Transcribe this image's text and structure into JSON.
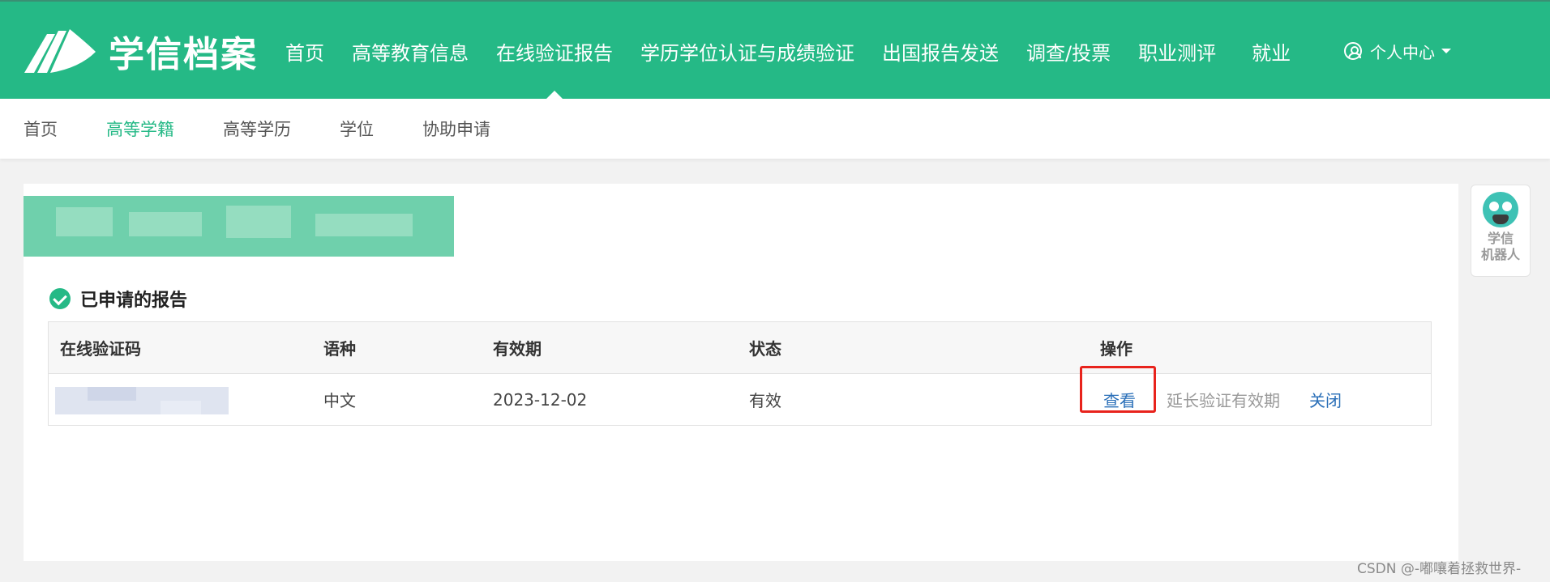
{
  "header": {
    "logo_text": "学信档案",
    "nav": [
      {
        "label": "首页",
        "active": false
      },
      {
        "label": "高等教育信息",
        "active": false
      },
      {
        "label": "在线验证报告",
        "active": true
      },
      {
        "label": "学历学位认证与成绩验证",
        "active": false
      },
      {
        "label": "出国报告发送",
        "active": false
      },
      {
        "label": "调查/投票",
        "active": false
      },
      {
        "label": "职业测评",
        "active": false
      },
      {
        "label": "就业",
        "active": false
      }
    ],
    "user_center": "个人中心"
  },
  "subnav": {
    "items": [
      {
        "label": "首页",
        "active": false
      },
      {
        "label": "高等学籍",
        "active": true
      },
      {
        "label": "高等学历",
        "active": false
      },
      {
        "label": "学位",
        "active": false
      },
      {
        "label": "协助申请",
        "active": false
      }
    ]
  },
  "reports": {
    "title": "已申请的报告",
    "columns": [
      "在线验证码",
      "语种",
      "有效期",
      "状态",
      "操作"
    ],
    "rows": [
      {
        "code": "",
        "language": "中文",
        "expiry": "2023-12-02",
        "status": "有效",
        "actions": {
          "view": "查看",
          "extend": "延长验证有效期",
          "close": "关闭"
        }
      }
    ]
  },
  "robot": {
    "label": "学信\n机器人"
  },
  "watermark": "CSDN @-嘟嚷着拯救世界-",
  "colors": {
    "brand": "#25b986",
    "link": "#2a6fb8",
    "highlight": "#e8231c"
  }
}
